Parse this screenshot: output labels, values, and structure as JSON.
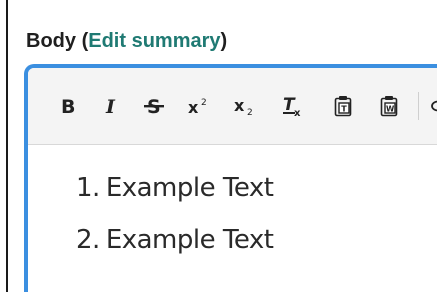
{
  "field": {
    "label": "Body",
    "open_paren": "(",
    "edit_link": "Edit summary",
    "close_paren": ")"
  },
  "toolbar": {
    "buttons": [
      {
        "name": "bold",
        "icon": "bold-icon"
      },
      {
        "name": "italic",
        "icon": "italic-icon"
      },
      {
        "name": "strikethrough",
        "icon": "strikethrough-icon"
      },
      {
        "name": "superscript",
        "icon": "superscript-icon"
      },
      {
        "name": "subscript",
        "icon": "subscript-icon"
      },
      {
        "name": "remove-format",
        "icon": "remove-format-icon"
      },
      {
        "name": "paste-as-text",
        "icon": "paste-text-icon"
      },
      {
        "name": "paste-from-word",
        "icon": "paste-word-icon"
      },
      {
        "name": "link",
        "icon": "link-icon"
      }
    ]
  },
  "content": {
    "list": [
      {
        "number": "1.",
        "text": "Example Text"
      },
      {
        "number": "2.",
        "text": "Example Text"
      }
    ]
  },
  "colors": {
    "link": "#1f7a73",
    "editor_border": "#3b8fe0",
    "toolbar_bg": "#f4f4f4"
  }
}
